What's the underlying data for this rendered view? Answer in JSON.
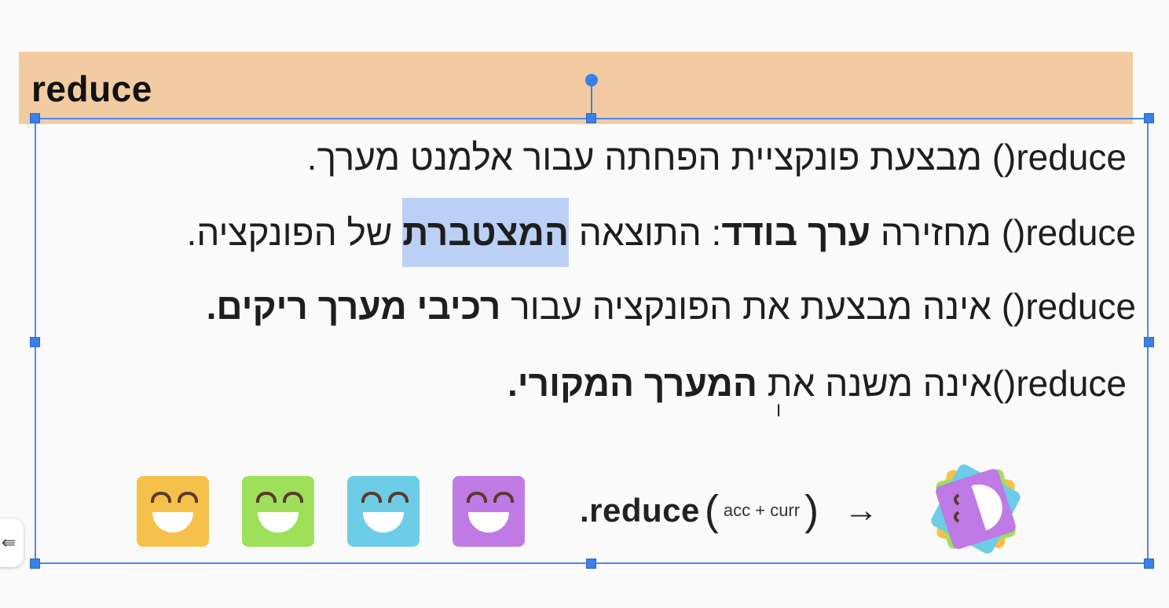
{
  "slide": {
    "title": "reduce",
    "lines": [
      {
        "parts": [
          {
            "text": "reduce() מבצעת פונקציית הפחתה עבור אלמנט מערך.",
            "bold": false
          }
        ]
      },
      {
        "parts": [
          {
            "text": "reduce() מחזירה ",
            "bold": false
          },
          {
            "text": "ערך בודד",
            "bold": true
          },
          {
            "text": ": התוצאה ",
            "bold": false
          },
          {
            "text": "המצטברת",
            "bold": true,
            "highlight": true
          },
          {
            "text": " של הפונקציה.",
            "bold": false
          }
        ]
      },
      {
        "parts": [
          {
            "text": "reduce() אינה מבצעת את הפונקציה עבור ",
            "bold": false
          },
          {
            "text": "רכיבי מערך ריקים.",
            "bold": true
          }
        ]
      },
      {
        "parts": [
          {
            "text": "reduce()אינה משנה את ",
            "bold": false
          },
          {
            "text": "המערך המקורי.",
            "bold": true
          }
        ]
      }
    ],
    "formula": {
      "method": ".reduce",
      "open_paren": "(",
      "args": "acc + curr",
      "close_paren": ")",
      "arrow": "→"
    },
    "faces": [
      {
        "color": "#f6c14a",
        "icon": "smiley-yellow"
      },
      {
        "color": "#9ee05a",
        "icon": "smiley-green"
      },
      {
        "color": "#6dcde6",
        "icon": "smiley-blue"
      },
      {
        "color": "#c07ae6",
        "icon": "smiley-purple"
      }
    ],
    "header_color": "#f2cba2",
    "selection_color": "#3b7fe8",
    "highlight_color": "#bcd0f6"
  },
  "ui": {
    "side_tab_icon": "collapse-menu-icon",
    "side_tab_glyph": "⇚",
    "cursor_glyph": "I"
  }
}
